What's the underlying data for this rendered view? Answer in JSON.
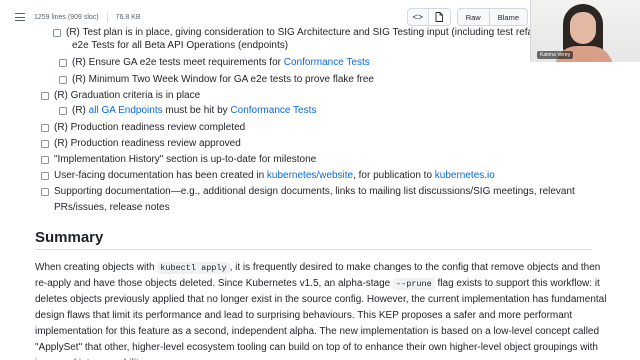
{
  "file_header": {
    "lines_info": "1259 lines (909 sloc)",
    "size": "76.8 KB",
    "code_btn": "<>",
    "preview_icon": "preview-icon",
    "raw_label": "Raw",
    "blame_label": "Blame"
  },
  "checklist": [
    {
      "pre": "(R) Test plan is in place, giving consideration to SIG Architecture and SIG Testing input (including test refactors)",
      "link": "",
      "post": "",
      "link2": "",
      "post2": ""
    },
    {
      "pre": "e2e Tests for all Beta API Operations (endpoints)",
      "link": "",
      "post": "",
      "link2": "",
      "post2": ""
    },
    {
      "pre": "(R) Ensure GA e2e tests meet requirements for ",
      "link": "Conformance Tests",
      "post": "",
      "link2": "",
      "post2": ""
    },
    {
      "pre": "(R) Minimum Two Week Window for GA e2e tests to prove flake free",
      "link": "",
      "post": "",
      "link2": "",
      "post2": ""
    },
    {
      "pre": "(R) Graduation criteria is in place",
      "link": "",
      "post": "",
      "link2": "",
      "post2": ""
    },
    {
      "pre": "(R) ",
      "link": "all GA Endpoints",
      "post": " must be hit by ",
      "link2": "Conformance Tests",
      "post2": ""
    },
    {
      "pre": "(R) Production readiness review completed",
      "link": "",
      "post": "",
      "link2": "",
      "post2": ""
    },
    {
      "pre": "(R) Production readiness review approved",
      "link": "",
      "post": "",
      "link2": "",
      "post2": ""
    },
    {
      "pre": "\"Implementation History\" section is up-to-date for milestone",
      "link": "",
      "post": "",
      "link2": "",
      "post2": ""
    },
    {
      "pre": "User-facing documentation has been created in ",
      "link": "kubernetes/website",
      "post": ", for publication to ",
      "link2": "kubernetes.io",
      "post2": ""
    },
    {
      "pre": "Supporting documentation—e.g., additional design documents, links to mailing list discussions/SIG meetings, relevant PRs/issues, release notes",
      "link": "",
      "post": "",
      "link2": "",
      "post2": ""
    }
  ],
  "summary": {
    "heading": "Summary",
    "p1_a": "When creating objects with ",
    "code1": "kubectl apply",
    "p1_b": ", it is frequently desired to make changes to the config that remove objects and then re-apply and have those objects deleted. Since Kubernetes v1.5, an alpha-stage ",
    "code2": "--prune",
    "p1_c": " flag exists to support this workflow: it deletes objects previously applied that no longer exist in the source config. However, the current implementation has fundamental design flaws that limit its performance and lead to surprising behaviours. This KEP proposes a safer and more performant implementation for this feature as a second, independent alpha. The new implementation is based on a low-level concept called \"ApplySet\" that other, higher-level ecosystem tooling can build on top of to enhance their own higher-level object groupings with improved interoperability."
  },
  "video": {
    "participant_name": "Katrina Verey"
  }
}
